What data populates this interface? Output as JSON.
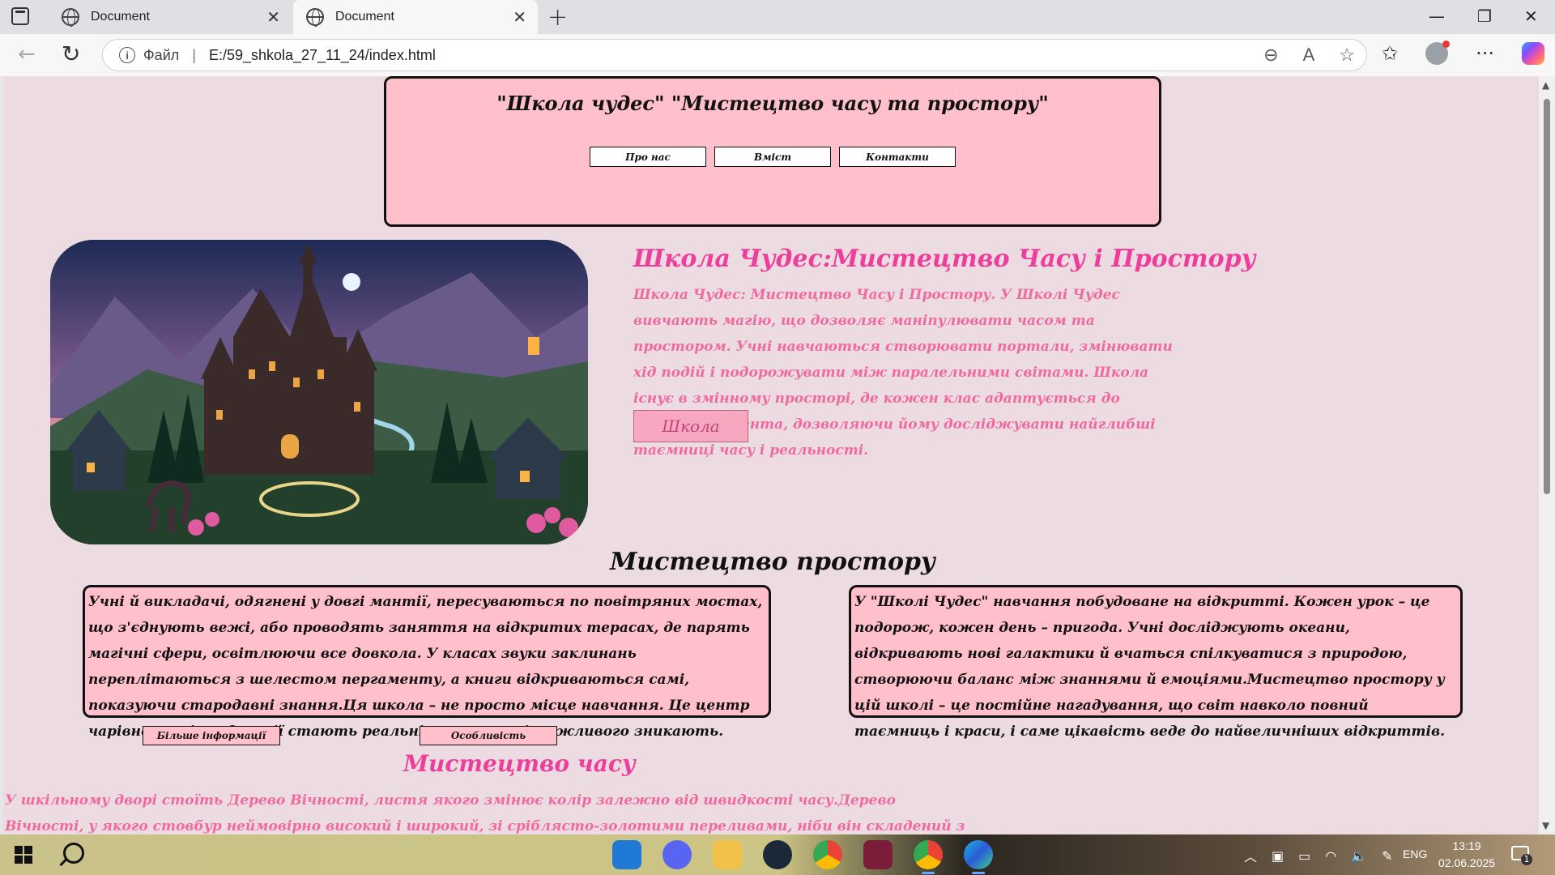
{
  "browser": {
    "tabs": [
      {
        "title": "Document",
        "active": false
      },
      {
        "title": "Document",
        "active": true
      }
    ],
    "address": {
      "scheme_label": "Файл",
      "url": "E:/59_shkola_27_11_24/index.html"
    }
  },
  "page": {
    "header": {
      "title": "\"Школа чудес\" \"Мистецтво часу та простору\"",
      "nav": [
        "Про нас",
        "Вміст",
        "Контакти"
      ]
    },
    "hero": {
      "heading": "Школа Чудес:Мистецтво Часу і Простору",
      "text": "Школа Чудес: Мистецтво Часу і Простору. У Школі Чудес вивчають магію, що дозволяє маніпулювати часом та простором. Учні навчаються створювати портали, змінювати хід подій і подорожувати між паралельними світами. Школа існує в змінному просторі, де кожен клас адаптується до потреб студента, дозволяючи йому досліджувати найглибші таємниці часу і реальності.",
      "button": "Школа"
    },
    "space": {
      "heading": "Мистецтво простору",
      "card1": "Учні й викладачі, одягнені у довгі мантії, пересуваються по повітряних мостах, що з'єднують вежі, або проводять заняття на відкритих терасах, де парять магічні сфери, освітлюючи все довкола. У класах звуки заклинань переплітаються з шелестом пергаменту, а книги відкриваються самі, показуючи стародавні знання.Ця школа – не просто місце навчання. Це центр чарівного світу, де мрії стають реальністю, а межі можливого зникають.",
      "card2": "У \"Школі Чудес\" навчання побудоване на відкритті. Кожен урок – це подорож, кожен день – пригода. Учні досліджують океани, відкривають нові галактики й вчаться спілкуватися з природою, створюючи баланс між знаннями й емоціями.Мистецтво простору у цій школі – це постійне нагадування, що світ навколо повний таємниць і краси, і саме цікавість веде до найвеличніших відкриттів.",
      "btn_more": "Більше інформації",
      "btn_features": "Особливість"
    },
    "time": {
      "heading": "Мистецтво часу",
      "text": "У шкільному дворі стоїть Дерево Вічності, листя якого змінює колір залежно від швидкості часу.Дерево Вічності, у якого стовбур неймовірно високий і широкий, зі сріблясто-золотими переливами, ніби він складений з чистого світла та ефірних ниток часу. Кора вкрита древніми"
    },
    "colors": {
      "background": "#ecdbe0",
      "card": "#ffc0cb",
      "accent_pink": "#ee3e9b"
    }
  },
  "taskbar": {
    "apps": [
      "vscode-icon",
      "discord-icon",
      "file-explorer-icon",
      "steam-icon",
      "chrome-icon",
      "app-icon",
      "chrome-profile-icon",
      "edge-icon"
    ],
    "language": "ENG",
    "time": "13:19",
    "date": "02.06.2025",
    "notifications": "1"
  }
}
